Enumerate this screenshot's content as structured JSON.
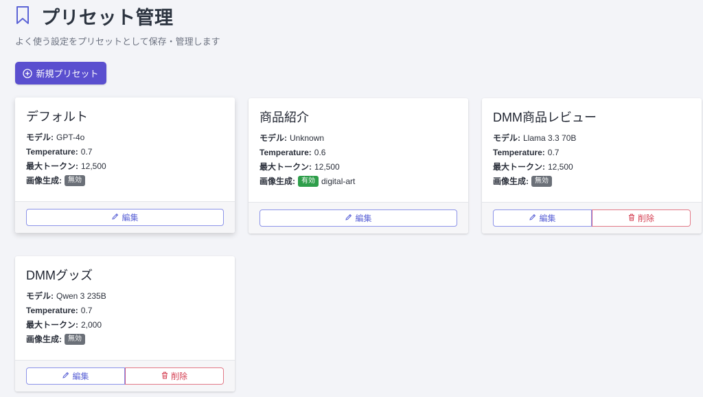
{
  "header": {
    "icon": "bookmark-icon",
    "title": "プリセット管理",
    "subtitle": "よく使う設定をプリセットとして保存・管理します"
  },
  "actions": {
    "new_preset_label": "新規プリセット",
    "new_preset_icon": "plus-circle-icon"
  },
  "labels": {
    "model": "モデル:",
    "temperature": "Temperature:",
    "max_tokens": "最大トークン:",
    "image_gen": "画像生成:",
    "edit": "編集",
    "delete": "削除"
  },
  "presets": [
    {
      "name": "デフォルト",
      "model": "GPT-4o",
      "temperature": "0.7",
      "max_tokens": "12,500",
      "image_gen_badge": "無効",
      "image_gen_enabled": false,
      "image_style": ""
    },
    {
      "name": "商品紹介",
      "model": "Unknown",
      "temperature": "0.6",
      "max_tokens": "12,500",
      "image_gen_badge": "有効",
      "image_gen_enabled": true,
      "image_style": "digital-art"
    },
    {
      "name": "DMM商品レビュー",
      "model": "Llama 3.3 70B",
      "temperature": "0.7",
      "max_tokens": "12,500",
      "image_gen_badge": "無効",
      "image_gen_enabled": false,
      "image_style": ""
    },
    {
      "name": "DMMグッズ",
      "model": "Qwen 3 235B",
      "temperature": "0.7",
      "max_tokens": "2,000",
      "image_gen_badge": "無効",
      "image_gen_enabled": false,
      "image_style": ""
    }
  ],
  "colors": {
    "primary": "#5a4fcf",
    "edit": "#5b63d6",
    "delete": "#d43f52",
    "badge_on": "#2e9e4a",
    "badge_off": "#6b7078"
  }
}
